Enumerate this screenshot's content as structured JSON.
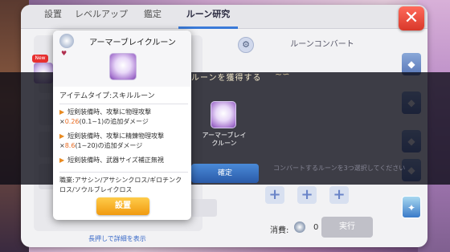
{
  "tabs": [
    {
      "label": "設置"
    },
    {
      "label": "レベルアップ"
    },
    {
      "label": "鑑定"
    },
    {
      "label": "ルーン研究",
      "active": true
    }
  ],
  "close_label": "✕",
  "convert": {
    "title": "ルーンコンバート",
    "consume_label": "消費:",
    "consume_count": "0",
    "exec_label": "実行",
    "plus_label": "+"
  },
  "help_link": "長押しで詳細を表示",
  "new_badge": "New",
  "obtain": {
    "title": "ルーンを獲得する",
    "rune_name": "アーマーブレイクルーン",
    "confirm_label": "確定",
    "notice": "コンバートするルーンを3つ選択してください"
  },
  "card": {
    "title": "アーマーブレイクルーン",
    "item_type": "アイテムタイプ:スキルルーン",
    "effect1_pre": "短剣装備時、攻撃に物理攻撃×",
    "effect1_num": "0.26",
    "effect1_post": "(0.1~1)の追加ダメージ",
    "effect2_pre": "短剣装備時、攻撃に精錬物理攻撃×",
    "effect2_num": "8.6",
    "effect2_post": "(1~20)の追加ダメージ",
    "effect3": "短剣装備時、武器サイズ補正無視",
    "jobs": "職業:アサシン/アサシンクロス/ギロチンクロス/ソウルブレイクロス",
    "equip_label": "設置"
  },
  "colors": {
    "accent": "#3a7ad8",
    "close": "#d8382a",
    "equip": "#f09a10",
    "highlight_number": "#e86a20"
  }
}
